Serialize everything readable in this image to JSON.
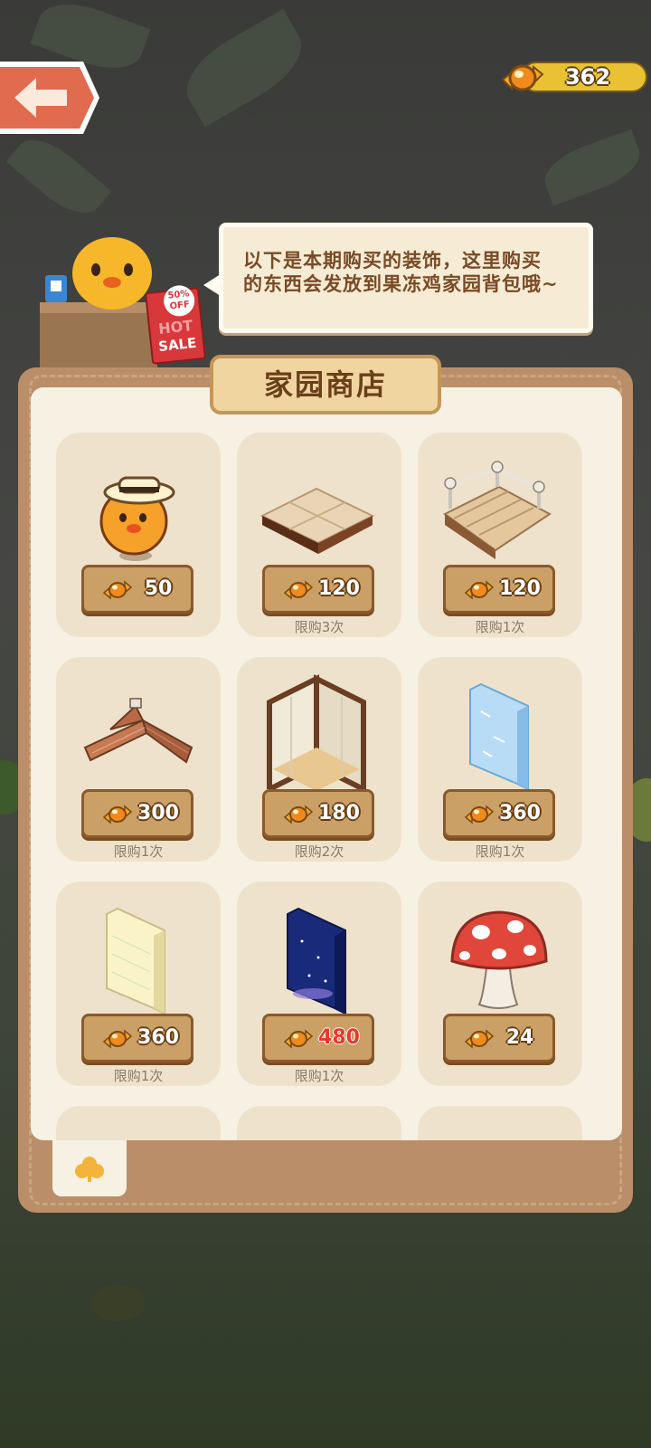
{
  "header": {
    "currency_value": "362"
  },
  "dialog": {
    "line1": "以下是本期购买的装饰，这里购买",
    "line2": "的东西会发放到果冻鸡家园背包哦~"
  },
  "stall": {
    "hot_sale": "HOT",
    "sale": "SALE",
    "discount": "50%",
    "off": "OFF"
  },
  "shop": {
    "title": "家园商店",
    "items": [
      {
        "name": "chick-with-hat",
        "price": "50",
        "limit": ""
      },
      {
        "name": "wooden-floor-tile",
        "price": "120",
        "limit": "限购3次"
      },
      {
        "name": "wooden-stairs",
        "price": "120",
        "limit": "限购1次"
      },
      {
        "name": "brick-roof",
        "price": "300",
        "limit": "限购1次"
      },
      {
        "name": "corner-wall",
        "price": "180",
        "limit": "限购2次"
      },
      {
        "name": "ice-wall-panel",
        "price": "360",
        "limit": "限购1次"
      },
      {
        "name": "cream-wall-panel",
        "price": "360",
        "limit": "限购1次"
      },
      {
        "name": "starry-wall-panel",
        "price": "480",
        "limit": "限购1次"
      },
      {
        "name": "red-mushroom",
        "price": "24",
        "limit": ""
      }
    ]
  },
  "tabs": [
    {
      "name": "clover-tab-icon"
    }
  ],
  "colors": {
    "panel": "#b98e68",
    "inner": "#f6f1e3",
    "card": "#efe2cc",
    "price_button": "#caa067",
    "highlight_price": "#e43a2a"
  }
}
